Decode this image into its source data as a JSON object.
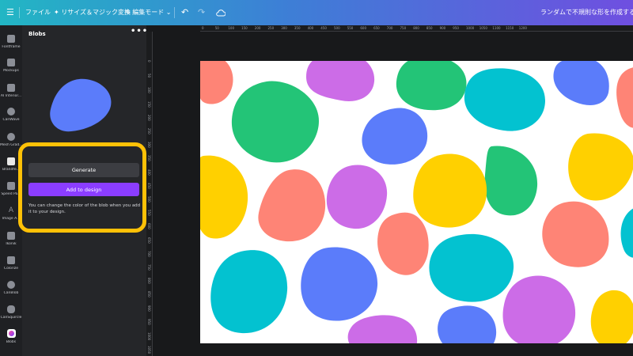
{
  "topbar": {
    "menu_icon": "hamburger-icon",
    "file_label": "ファイル",
    "resize_label": "リサイズ＆マジック変換",
    "edit_mode_label": "編集モード",
    "doc_title": "ランダムで不規則な形を作成する方法-レイ",
    "gradient_colors": [
      "#22b6c4",
      "#3d7fd6",
      "#6f4fe0"
    ]
  },
  "rail": {
    "items": [
      {
        "label": "Fontframe",
        "icon": "fontframe-icon"
      },
      {
        "label": "Mockups",
        "icon": "mockups-icon"
      },
      {
        "label": "AI Interior...",
        "icon": "ai-interior-icon"
      },
      {
        "label": "CanWave",
        "icon": "canwave-icon"
      },
      {
        "label": "Mesh Grad...",
        "icon": "mesh-gradient-icon"
      },
      {
        "label": "Brandfe...",
        "icon": "brandfetch-icon"
      },
      {
        "label": "Speed Pa...",
        "icon": "speed-paint-icon"
      },
      {
        "label": "Image A...",
        "icon": "image-ai-icon"
      },
      {
        "label": "Ikonik",
        "icon": "ikonik-icon"
      },
      {
        "label": "Colorize",
        "icon": "colorize-icon"
      },
      {
        "label": "CanBlob",
        "icon": "canblob-icon"
      },
      {
        "label": "CanSquircle",
        "icon": "cansquircle-icon"
      },
      {
        "label": "Blobs",
        "icon": "blobs-icon"
      }
    ]
  },
  "panel": {
    "title": "Blobs",
    "more_label": "•••",
    "preview_color": "#5b7cfa",
    "generate_label": "Generate",
    "add_label": "Add to design",
    "hint": "You can change the color of the blob when you add it to your design.",
    "highlight_color": "#ffc107",
    "accent_color": "#8b3dff"
  },
  "ruler": {
    "h_ticks": [
      "0",
      "50",
      "100",
      "150",
      "200",
      "250",
      "300",
      "350",
      "400",
      "450",
      "500",
      "550",
      "600",
      "650",
      "700",
      "750",
      "800",
      "850",
      "900",
      "950",
      "1000",
      "1050",
      "1100",
      "1150",
      "1200"
    ],
    "v_ticks": [
      "0",
      "50",
      "100",
      "150",
      "200",
      "250",
      "300",
      "350",
      "400",
      "450",
      "500",
      "550",
      "600",
      "650",
      "700",
      "750",
      "800",
      "850",
      "900",
      "950",
      "1000",
      "1050"
    ]
  },
  "canvas": {
    "background": "#ffffff",
    "blob_colors": [
      "#fe8476",
      "#cc6ce7",
      "#23c477",
      "#03c2d0",
      "#5b7cfa",
      "#ffd000"
    ]
  }
}
